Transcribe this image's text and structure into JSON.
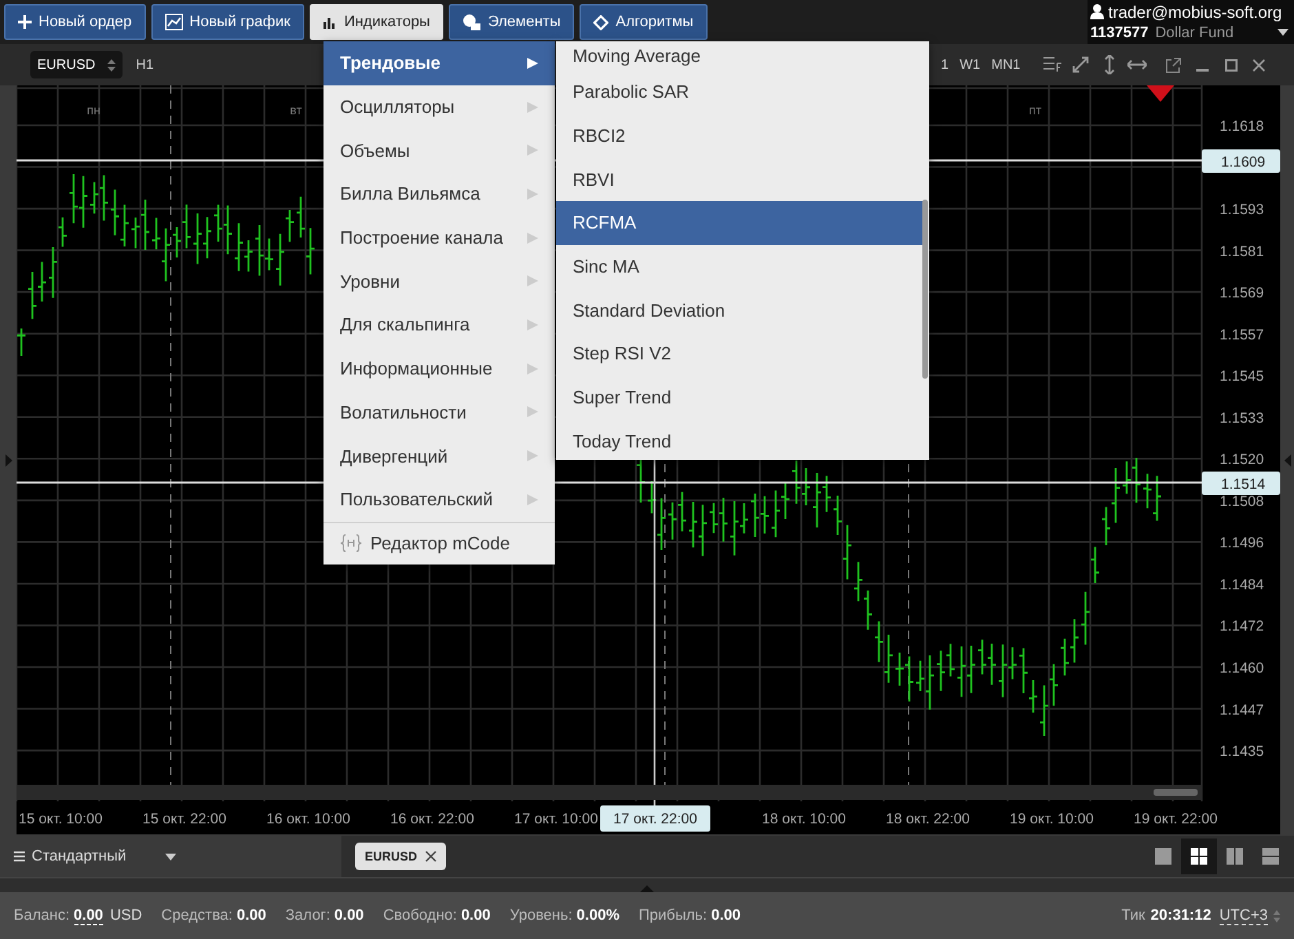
{
  "toolbar": {
    "buttons": [
      {
        "label": "Новый ордер",
        "selected": false
      },
      {
        "label": "Новый график",
        "selected": false
      },
      {
        "label": "Индикаторы",
        "selected": true
      },
      {
        "label": "Элементы",
        "selected": false
      },
      {
        "label": "Алгоритмы",
        "selected": false
      }
    ]
  },
  "account": {
    "email": "trader@mobius-soft.org",
    "number": "1137577",
    "name": "Dollar Fund"
  },
  "chart": {
    "symbol": "EURUSD",
    "timeframe": "H1",
    "periods": [
      "1",
      "W1",
      "MN1"
    ],
    "day_labels": [
      "пн",
      "вт",
      "пт"
    ],
    "price_labels": [
      "1.1618",
      "1.1593",
      "1.1581",
      "1.1569",
      "1.1557",
      "1.1545",
      "1.1533",
      "1.1520",
      "1.1508",
      "1.1496",
      "1.1484",
      "1.1472",
      "1.1460",
      "1.1447",
      "1.1435"
    ],
    "price_markers": [
      "1.1609",
      "1.1514"
    ],
    "time_labels": [
      "15 окт. 10:00",
      "15 окт. 22:00",
      "16 окт. 10:00",
      "16 окт. 22:00",
      "17 окт. 10:00",
      "18 окт. 10:00",
      "18 окт. 22:00",
      "19 окт. 10:00",
      "19 окт. 22:00"
    ],
    "cursor_time": "17 окт. 22:00"
  },
  "indicators_menu": {
    "items": [
      {
        "label": "Трендовые",
        "selected": true
      },
      {
        "label": "Осцилляторы",
        "selected": false
      },
      {
        "label": "Объемы",
        "selected": false
      },
      {
        "label": "Билла Вильямса",
        "selected": false
      },
      {
        "label": "Построение канала",
        "selected": false
      },
      {
        "label": "Уровни",
        "selected": false
      },
      {
        "label": "Для скальпинга",
        "selected": false
      },
      {
        "label": "Информационные",
        "selected": false
      },
      {
        "label": "Волатильности",
        "selected": false
      },
      {
        "label": "Дивергенций",
        "selected": false
      },
      {
        "label": "Пользовательский",
        "selected": false
      }
    ],
    "editor": "Редактор mCode"
  },
  "submenu": {
    "items": [
      {
        "label": "Moving Average",
        "selected": false
      },
      {
        "label": "Parabolic SAR",
        "selected": false
      },
      {
        "label": "RBCI2",
        "selected": false
      },
      {
        "label": "RBVI",
        "selected": false
      },
      {
        "label": "RCFMA",
        "selected": true
      },
      {
        "label": "Sinc MA",
        "selected": false
      },
      {
        "label": "Standard Deviation",
        "selected": false
      },
      {
        "label": "Step RSI V2",
        "selected": false
      },
      {
        "label": "Super Trend",
        "selected": false
      },
      {
        "label": "Today Trend",
        "selected": false
      }
    ]
  },
  "bottom_bar": {
    "workspace": "Стандартный",
    "tabs": [
      {
        "label": "EURUSD",
        "selected": true
      }
    ],
    "layouts": [
      {
        "selected": false
      },
      {
        "selected": true
      },
      {
        "selected": false
      },
      {
        "selected": false
      }
    ]
  },
  "status_bar": {
    "items": [
      {
        "label": "Баланс:",
        "value": "0.00",
        "unit": "USD",
        "underlined": true
      },
      {
        "label": "Средства:",
        "value": "0.00",
        "underlined": false
      },
      {
        "label": "Залог:",
        "value": "0.00",
        "underlined": false
      },
      {
        "label": "Свободно:",
        "value": "0.00",
        "underlined": false
      },
      {
        "label": "Уровень:",
        "value": "0.00%",
        "underlined": false
      },
      {
        "label": "Прибыль:",
        "value": "0.00",
        "underlined": false
      }
    ],
    "tick_label": "Тик",
    "time": "20:31:12",
    "timezone": "UTC+3"
  }
}
